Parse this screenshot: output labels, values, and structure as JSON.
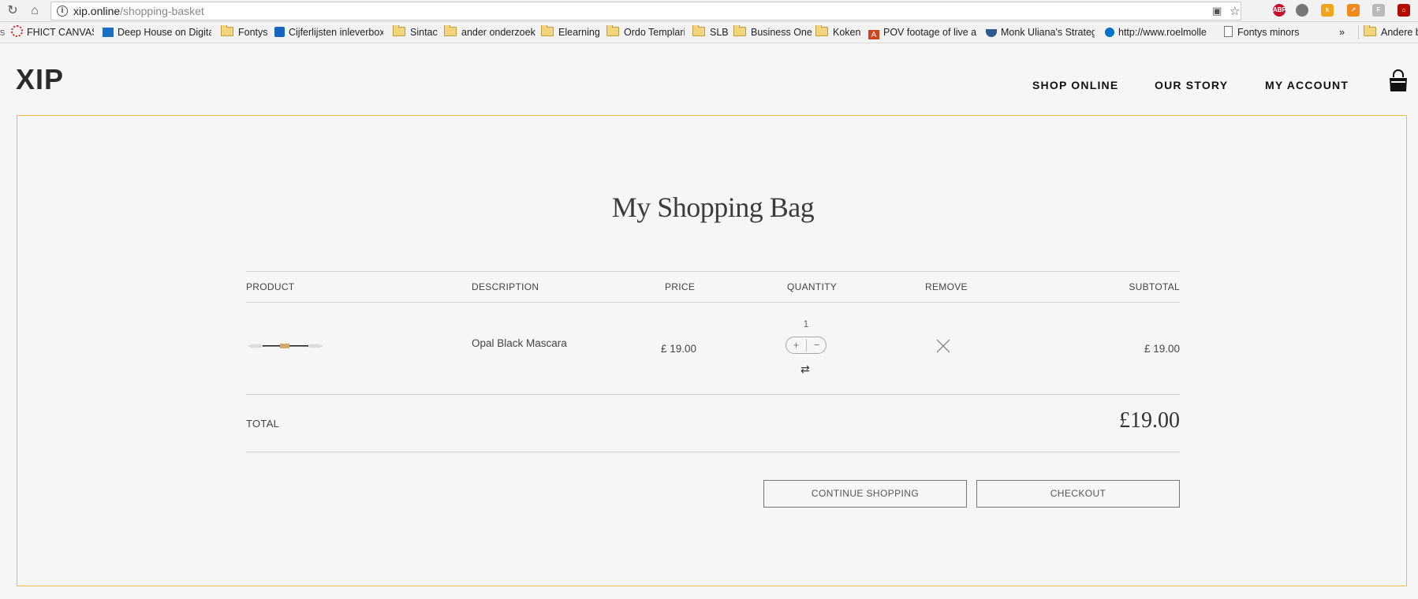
{
  "browser": {
    "url_host": "xip.online",
    "url_path": "/shopping-basket",
    "ext_abp": "ABP",
    "ext_f": "F",
    "bookmarks": [
      {
        "label": "FHICT CANVAS",
        "icon": "ring-icon"
      },
      {
        "label": "Deep House on Digita",
        "icon": "site-icon"
      },
      {
        "label": "Fontys",
        "icon": "folder-icon"
      },
      {
        "label": "Cijferlijsten inleverbox",
        "icon": "sharepoint-icon"
      },
      {
        "label": "Sintac",
        "icon": "folder-icon"
      },
      {
        "label": "ander onderzoek",
        "icon": "folder-icon"
      },
      {
        "label": "Elearning",
        "icon": "folder-icon"
      },
      {
        "label": "Ordo Templari",
        "icon": "folder-icon"
      },
      {
        "label": "SLB",
        "icon": "folder-icon"
      },
      {
        "label": "Business One",
        "icon": "folder-icon"
      },
      {
        "label": "Koken",
        "icon": "folder-icon"
      },
      {
        "label": "POV footage of live a",
        "icon": "pdf-icon"
      },
      {
        "label": "Monk Uliana's Strateg",
        "icon": "ship-icon"
      },
      {
        "label": "http://www.roelmolle",
        "icon": "dot-icon"
      },
      {
        "label": "Fontys minors",
        "icon": "page-icon"
      }
    ],
    "more_label": "»",
    "other_bookmarks": "Andere b"
  },
  "site": {
    "logo": "XIP",
    "nav": [
      "SHOP ONLINE",
      "OUR STORY",
      "MY ACCOUNT"
    ]
  },
  "basket": {
    "title": "My Shopping Bag",
    "columns": {
      "product": "PRODUCT",
      "description": "DESCRIPTION",
      "price": "PRICE",
      "quantity": "QUANTITY",
      "remove": "REMOVE",
      "subtotal": "SUBTOTAL"
    },
    "items": [
      {
        "description": "Opal Black Mascara",
        "price": "£ 19.00",
        "quantity": "1",
        "subtotal": "£ 19.00"
      }
    ],
    "stepper_plus": "+",
    "stepper_minus": "−",
    "total_label": "TOTAL",
    "total_value": "£19.00",
    "continue_label": "CONTINUE SHOPPING",
    "checkout_label": "CHECKOUT"
  },
  "colors": {
    "panel_border": "#f2b84a",
    "background": "#f6f6f6"
  }
}
